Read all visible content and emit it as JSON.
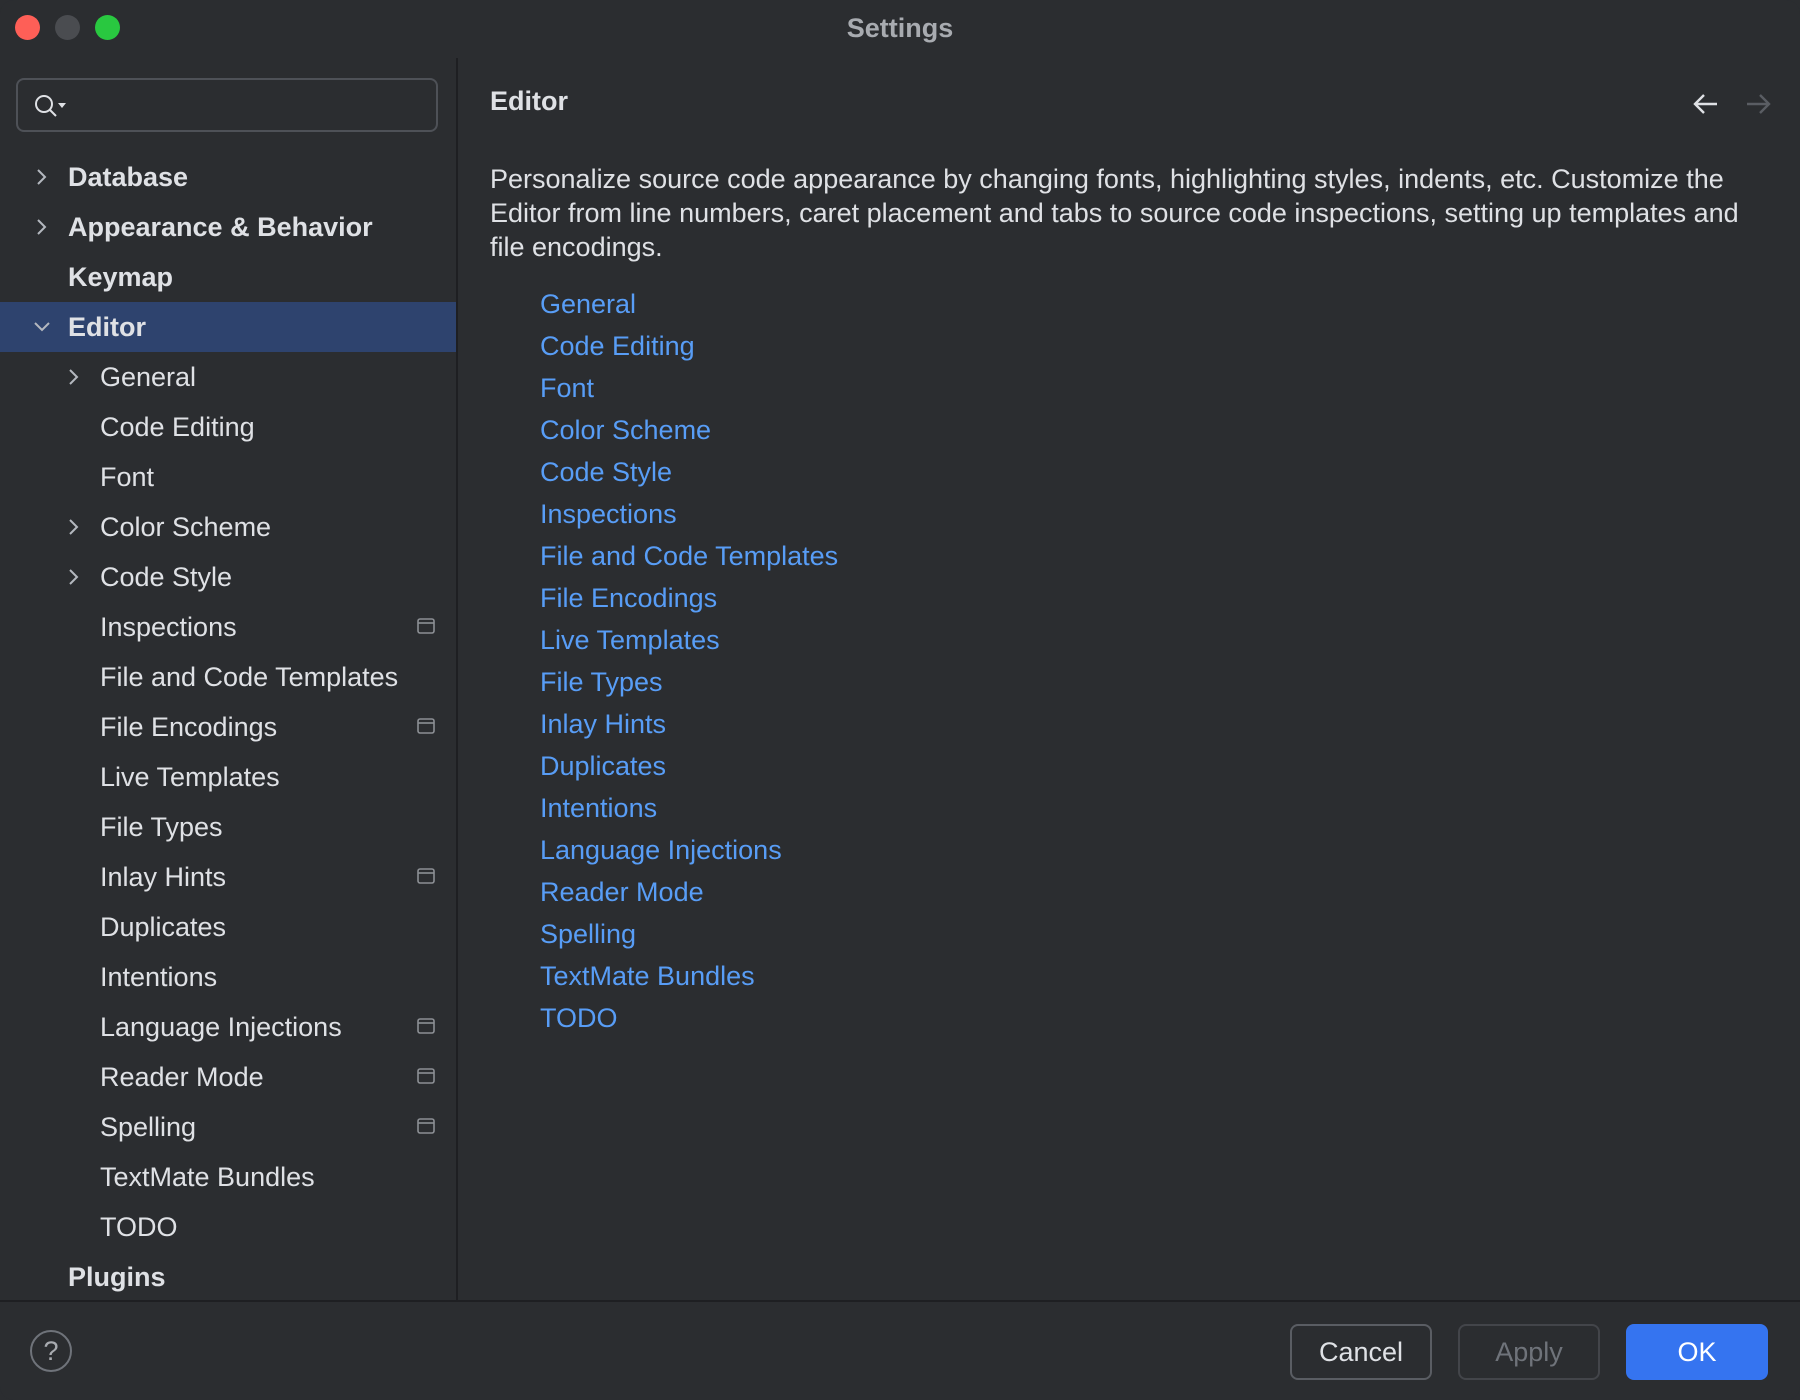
{
  "window": {
    "title": "Settings"
  },
  "search": {
    "placeholder": ""
  },
  "sidebar": {
    "items": [
      {
        "label": "Database",
        "expandable": true,
        "expanded": false
      },
      {
        "label": "Appearance & Behavior",
        "expandable": true,
        "expanded": false
      },
      {
        "label": "Keymap",
        "expandable": false
      },
      {
        "label": "Editor",
        "expandable": true,
        "expanded": true,
        "selected": true
      },
      {
        "label": "General",
        "expandable": true,
        "expanded": false
      },
      {
        "label": "Code Editing"
      },
      {
        "label": "Font"
      },
      {
        "label": "Color Scheme",
        "expandable": true,
        "expanded": false
      },
      {
        "label": "Code Style",
        "expandable": true,
        "expanded": false
      },
      {
        "label": "Inspections",
        "project_icon": true
      },
      {
        "label": "File and Code Templates"
      },
      {
        "label": "File Encodings",
        "project_icon": true
      },
      {
        "label": "Live Templates"
      },
      {
        "label": "File Types"
      },
      {
        "label": "Inlay Hints",
        "project_icon": true
      },
      {
        "label": "Duplicates"
      },
      {
        "label": "Intentions"
      },
      {
        "label": "Language Injections",
        "project_icon": true
      },
      {
        "label": "Reader Mode",
        "project_icon": true
      },
      {
        "label": "Spelling",
        "project_icon": true
      },
      {
        "label": "TextMate Bundles"
      },
      {
        "label": "TODO"
      },
      {
        "label": "Plugins"
      }
    ]
  },
  "main": {
    "title": "Editor",
    "description": "Personalize source code appearance by changing fonts, highlighting styles, indents, etc. Customize the Editor from line numbers, caret placement and tabs to source code inspections, setting up templates and file encodings.",
    "links": [
      "General",
      "Code Editing",
      "Font",
      "Color Scheme",
      "Code Style",
      "Inspections",
      "File and Code Templates",
      "File Encodings",
      "Live Templates",
      "File Types",
      "Inlay Hints",
      "Duplicates",
      "Intentions",
      "Language Injections",
      "Reader Mode",
      "Spelling",
      "TextMate Bundles",
      "TODO"
    ]
  },
  "buttons": {
    "help": "?",
    "cancel": "Cancel",
    "apply": "Apply",
    "ok": "OK"
  },
  "colors": {
    "link": "#589df6",
    "selection": "#2e436e",
    "ok_button": "#3574f0",
    "background": "#2b2d30"
  }
}
